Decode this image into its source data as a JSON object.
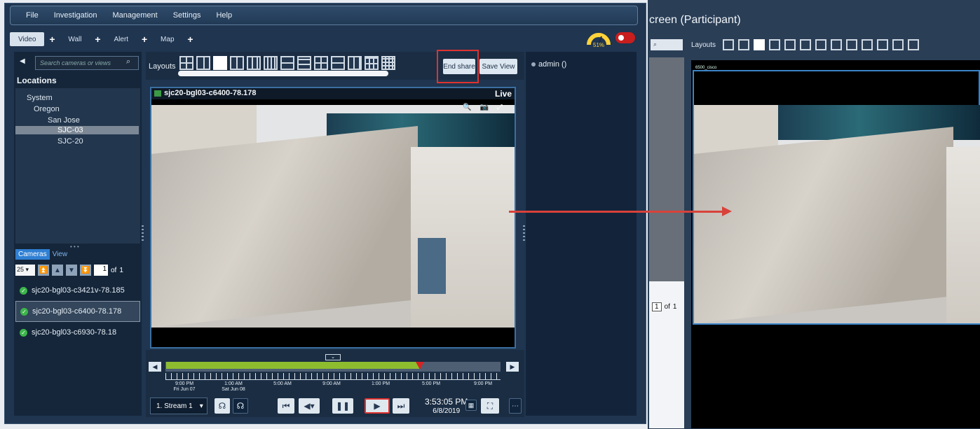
{
  "menu": [
    "File",
    "Investigation",
    "Management",
    "Settings",
    "Help"
  ],
  "tabs": [
    {
      "label": "Video",
      "active": true
    },
    {
      "label": "Wall",
      "active": false
    },
    {
      "label": "Alert",
      "active": false
    },
    {
      "label": "Map",
      "active": false
    }
  ],
  "gauge": {
    "percent": "51%"
  },
  "search": {
    "placeholder": "Search cameras or views"
  },
  "locations": {
    "title": "Locations",
    "tree": [
      {
        "label": "System",
        "level": 0,
        "selected": false
      },
      {
        "label": "Oregon",
        "level": 1,
        "selected": false
      },
      {
        "label": "San Jose",
        "level": 2,
        "selected": false
      },
      {
        "label": "SJC-03",
        "level": 3,
        "selected": true
      },
      {
        "label": "SJC-20",
        "level": 3,
        "selected": false
      }
    ]
  },
  "camera_tabs": [
    {
      "label": "Cameras",
      "active": true
    },
    {
      "label": "View",
      "active": false
    }
  ],
  "pager": {
    "per_page": "25",
    "page": "1",
    "of_label": "of",
    "total": "1"
  },
  "cameras": [
    {
      "label": "sjc20-bgl03-c3421v-78.185",
      "selected": false
    },
    {
      "label": "sjc20-bgl03-c6400-78.178",
      "selected": true
    },
    {
      "label": "sjc20-bgl03-c6930-78.18",
      "selected": false
    }
  ],
  "layouts": {
    "label": "Layouts",
    "end_share": "End share",
    "save_view": "Save View"
  },
  "users": {
    "admin": "admin ()"
  },
  "video": {
    "title": "sjc20-bgl03-c6400-78.178",
    "status": "Live"
  },
  "timeline": {
    "progress": 0.76,
    "labels": [
      {
        "time": "9:00 PM",
        "date": "Fri Jun 07"
      },
      {
        "time": "1:00 AM",
        "date": "Sat Jun 08"
      },
      {
        "time": "5:00 AM",
        "date": ""
      },
      {
        "time": "9:00 AM",
        "date": ""
      },
      {
        "time": "1:00 PM",
        "date": ""
      },
      {
        "time": "5:00 PM",
        "date": ""
      },
      {
        "time": "9:00 PM",
        "date": ""
      }
    ]
  },
  "controls": {
    "stream": "1. Stream 1",
    "time": "3:53:05 PM",
    "date": "6/8/2019"
  },
  "participant": {
    "title": "creen (Participant)",
    "layouts_label": "Layouts",
    "camera_label": "6500_cisco",
    "page": "1",
    "of_label": "of",
    "total": "1"
  },
  "colors": {
    "accent": "#2f7fd3",
    "highlight": "#e0322e",
    "timeline_fill": "#8dbd2f",
    "marker": "#d42424"
  }
}
